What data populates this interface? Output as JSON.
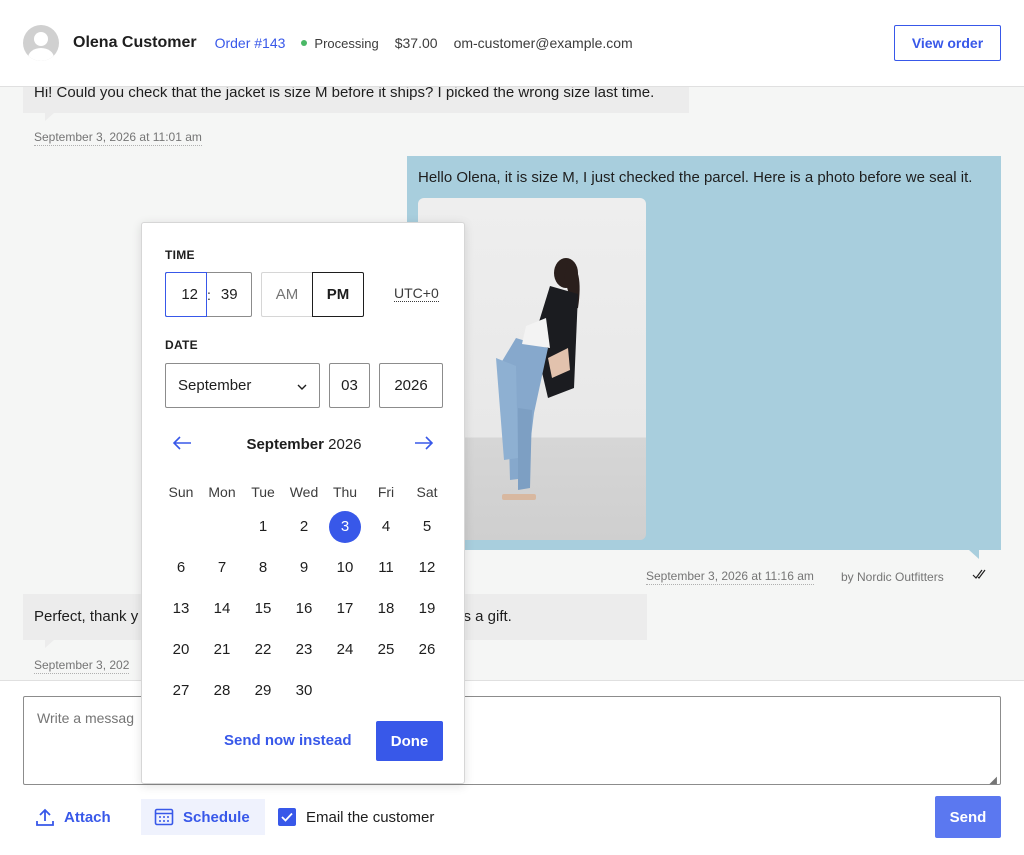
{
  "header": {
    "customer_name": "Olena Customer",
    "order_link": "Order #143",
    "status": "Processing",
    "status_color": "#4ab866",
    "amount": "$37.00",
    "email": "om-customer@example.com",
    "view_order_label": "View order"
  },
  "messages": [
    {
      "text": "Hi! Could you check that the jacket is size M before it ships? I picked the wrong size last time.",
      "timestamp": "September 3, 2026 at 11:01 am"
    },
    {
      "text": "Hello Olena, it is size M, I just checked the parcel. Here is a photo before we seal it.",
      "timestamp": "September 3, 2026 at 11:16 am",
      "byline": "by Nordic Outfitters",
      "read_icon": "double-check-icon"
    },
    {
      "text": "Perfect, thank y",
      "text_tail": "out of the box? It is a gift.",
      "timestamp": "September 3, 202"
    }
  ],
  "composer": {
    "placeholder": "Write a messag",
    "attach_label": "Attach",
    "schedule_label": "Schedule",
    "email_label": "Email the customer",
    "email_checked": true,
    "send_label": "Send"
  },
  "datepicker": {
    "time_label": "TIME",
    "hour": "12",
    "minute": "39",
    "am_label": "AM",
    "pm_label": "PM",
    "selected_period": "PM",
    "timezone": "UTC+0",
    "date_label": "DATE",
    "month": "September",
    "day": "03",
    "year": "2026",
    "calendar_month": "September",
    "calendar_year": "2026",
    "weekdays": [
      "Sun",
      "Mon",
      "Tue",
      "Wed",
      "Thu",
      "Fri",
      "Sat"
    ],
    "first_weekday_index": 2,
    "days_in_month": 30,
    "selected_day": 3,
    "send_now_label": "Send now instead",
    "done_label": "Done"
  },
  "colors": {
    "accent": "#3858e9",
    "agent_bubble": "#a8cedd",
    "customer_bubble": "#ececec"
  }
}
